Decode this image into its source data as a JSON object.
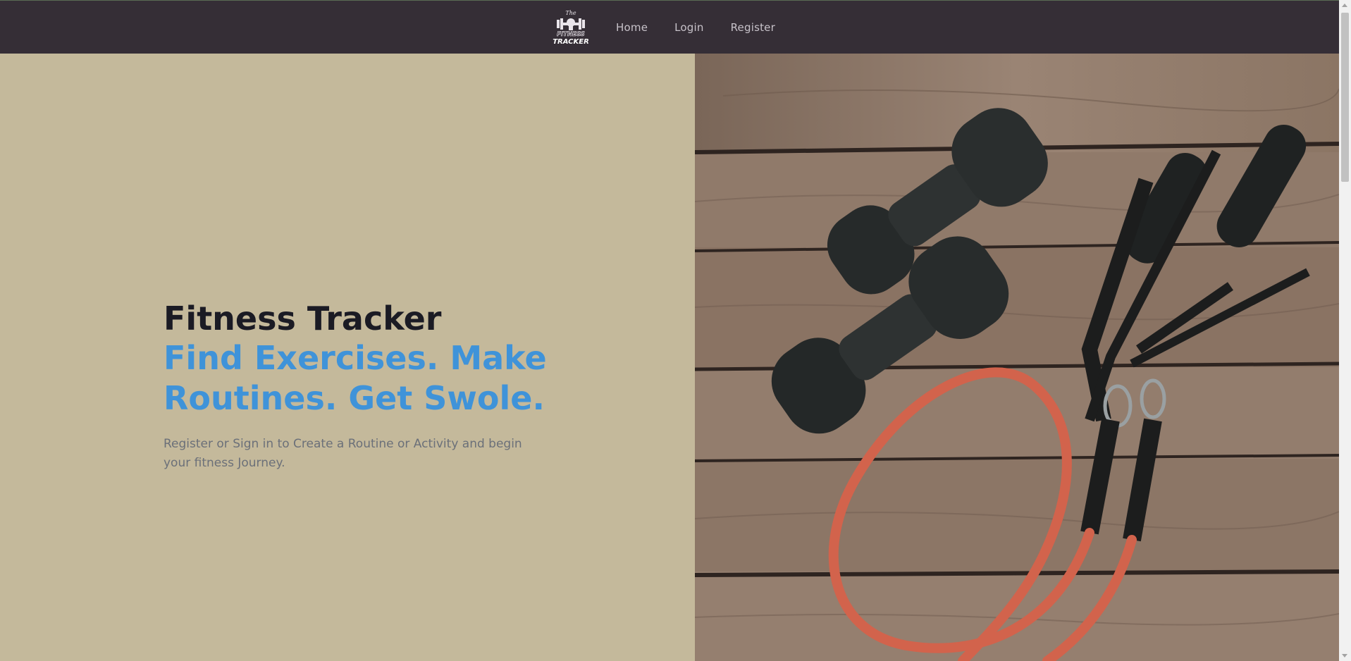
{
  "nav": {
    "logo_alt": "The Fitness Tracker",
    "links": [
      {
        "label": "Home"
      },
      {
        "label": "Login"
      },
      {
        "label": "Register"
      }
    ]
  },
  "hero": {
    "title": "Fitness Tracker",
    "tagline": "Find Exercises. Make Routines. Get Swole.",
    "description": "Register or Sign in to Create a Routine or Activity and begin your fitness Journey.",
    "image_icon": "dumbbells-and-resistance-band-photo"
  },
  "colors": {
    "navbar": "#352e36",
    "hero_bg": "#c4b99b",
    "title": "#1b1b24",
    "tagline": "#3f93d9",
    "description": "#6b7079"
  }
}
